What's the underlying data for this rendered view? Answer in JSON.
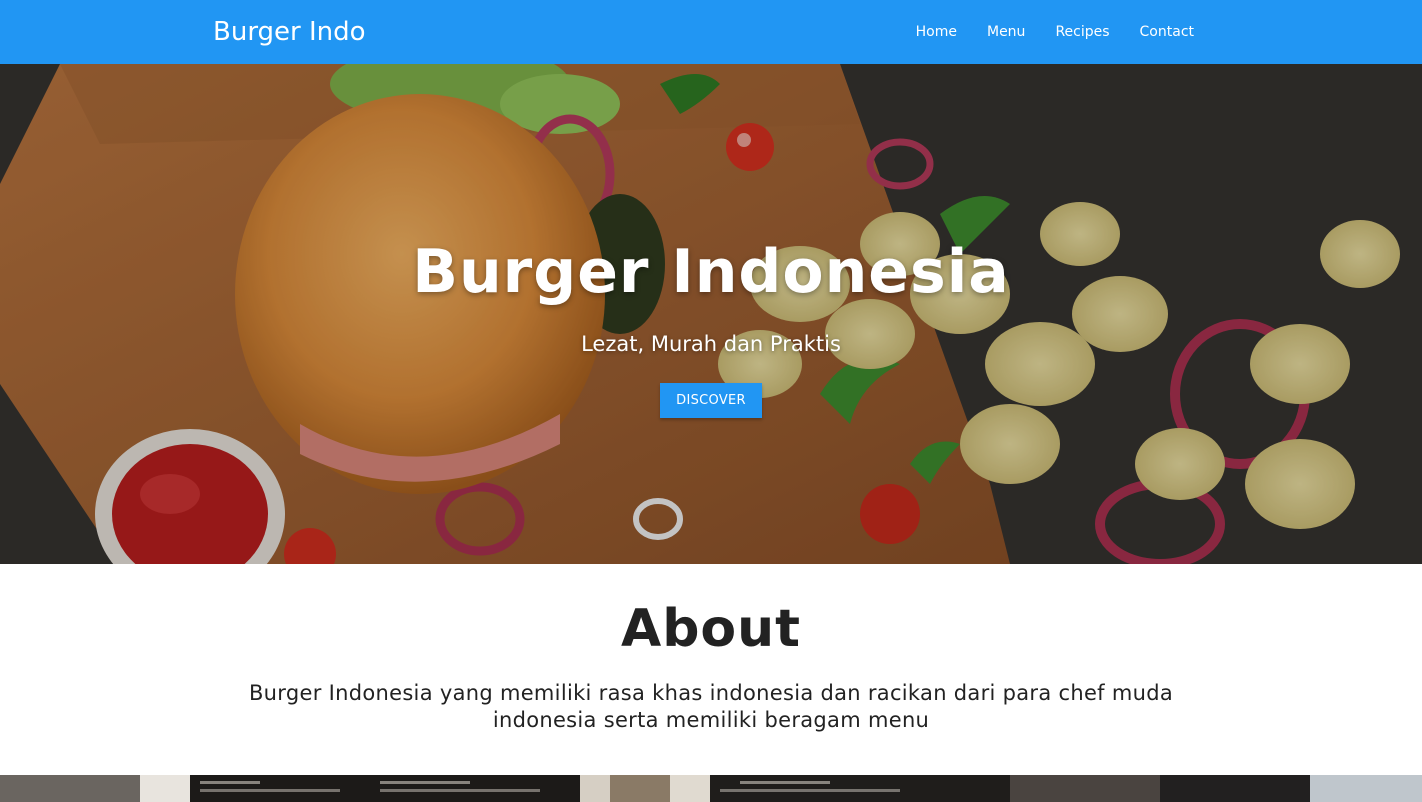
{
  "navbar": {
    "brand": "Burger Indo",
    "links": [
      "Home",
      "Menu",
      "Recipes",
      "Contact"
    ],
    "color": "#2196f3"
  },
  "hero": {
    "title": "Burger Indonesia",
    "subtitle": "Lezat, Murah dan Praktis",
    "button_label": "DISCOVER"
  },
  "about": {
    "title": "About",
    "text": "Burger Indonesia yang memiliki rasa khas indonesia dan racikan dari para chef muda indonesia serta memiliki beragam menu"
  }
}
